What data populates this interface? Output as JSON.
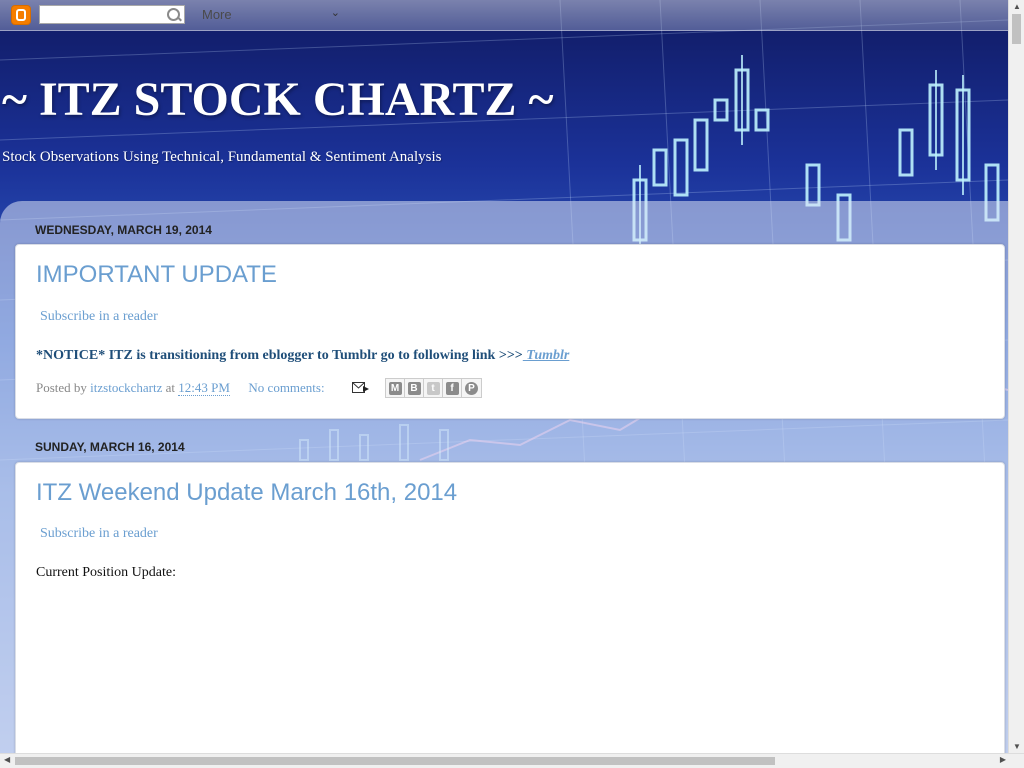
{
  "navbar": {
    "search_placeholder": "",
    "more_label": "More",
    "icons": [
      "blogger-logo-icon",
      "search-icon",
      "chevron-down-icon"
    ]
  },
  "header": {
    "title": "~ ITZ STOCK CHARTZ ~",
    "description": "Stock Observations Using Technical, Fundamental & Sentiment Analysis"
  },
  "posts": [
    {
      "date": "WEDNESDAY, MARCH 19, 2014",
      "title": "IMPORTANT UPDATE",
      "subscribe": "Subscribe in a reader",
      "notice_text": "*NOTICE* ITZ is transitioning from eblogger to Tumblr go to following link >>>",
      "notice_link": " Tumblr",
      "footer": {
        "posted_by": "Posted by",
        "author": "itzstockchartz",
        "at": "at",
        "time": "12:43 PM",
        "comments": "No comments:"
      },
      "share_buttons": [
        "email-share-icon",
        "blogthis-icon",
        "twitter-icon",
        "facebook-icon",
        "pinterest-icon"
      ]
    },
    {
      "date": "SUNDAY, MARCH 16, 2014",
      "title": "ITZ Weekend Update March 16th, 2014",
      "subscribe": "Subscribe in a reader",
      "body_text": "Current Position Update:"
    }
  ],
  "colors": {
    "accent": "#6a9ed0",
    "notice": "#1f4e79",
    "header_bg": "#1b3299"
  }
}
